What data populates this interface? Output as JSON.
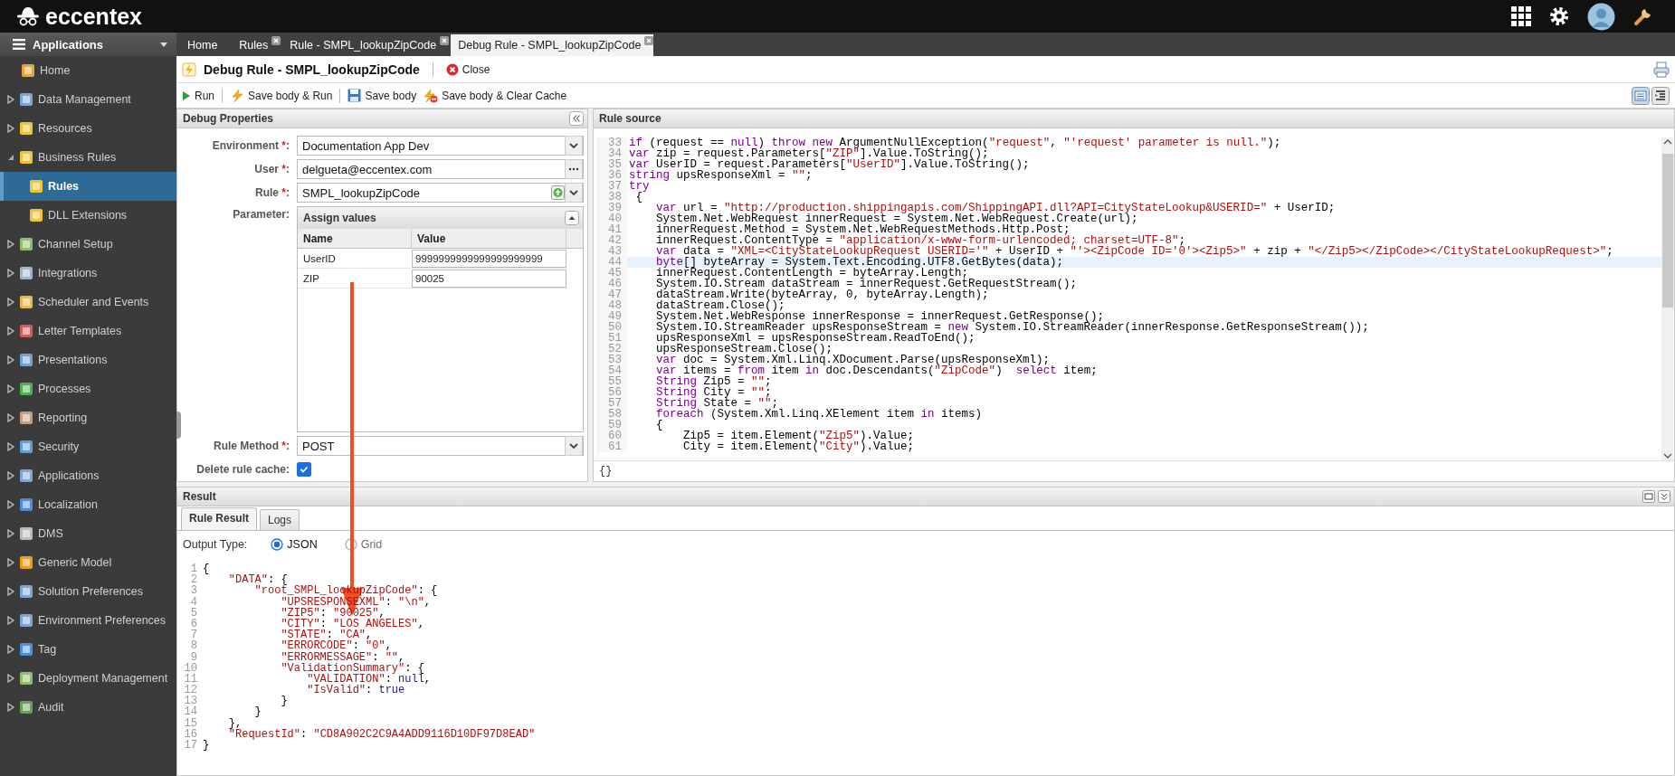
{
  "topbar": {
    "logo": "eccentex"
  },
  "sidebar": {
    "header": "Applications",
    "items": [
      {
        "label": "Home",
        "selected": false
      },
      {
        "label": "Data Management",
        "expanded": false,
        "selected": false
      },
      {
        "label": "Resources",
        "expanded": false,
        "selected": false
      },
      {
        "label": "Business Rules",
        "expanded": true,
        "selected": false,
        "children": [
          {
            "label": "Rules",
            "selected": true
          },
          {
            "label": "DLL Extensions",
            "selected": false
          }
        ]
      },
      {
        "label": "Channel Setup",
        "expanded": false,
        "selected": false
      },
      {
        "label": "Integrations",
        "expanded": false,
        "selected": false
      },
      {
        "label": "Scheduler and Events",
        "expanded": false,
        "selected": false
      },
      {
        "label": "Letter Templates",
        "expanded": false,
        "selected": false
      },
      {
        "label": "Presentations",
        "expanded": false,
        "selected": false
      },
      {
        "label": "Processes",
        "expanded": false,
        "selected": false
      },
      {
        "label": "Reporting",
        "expanded": false,
        "selected": false
      },
      {
        "label": "Security",
        "expanded": false,
        "selected": false
      },
      {
        "label": "Applications",
        "expanded": false,
        "selected": false
      },
      {
        "label": "Localization",
        "expanded": false,
        "selected": false
      },
      {
        "label": "DMS",
        "expanded": false,
        "selected": false
      },
      {
        "label": "Generic Model",
        "expanded": false,
        "selected": false
      },
      {
        "label": "Solution Preferences",
        "expanded": false,
        "selected": false
      },
      {
        "label": "Environment Preferences",
        "expanded": false,
        "selected": false
      },
      {
        "label": "Tag",
        "expanded": false,
        "selected": false
      },
      {
        "label": "Deployment Management",
        "expanded": false,
        "selected": false
      },
      {
        "label": "Audit",
        "expanded": false,
        "selected": false
      }
    ]
  },
  "tabs": [
    {
      "label": "Home",
      "closable": false,
      "selected": false
    },
    {
      "label": "Rules",
      "closable": true,
      "selected": false
    },
    {
      "label": "Rule - SMPL_lookupZipCode",
      "closable": true,
      "selected": false
    },
    {
      "label": "Debug Rule - SMPL_lookupZipCode",
      "closable": true,
      "selected": true
    }
  ],
  "page": {
    "title": "Debug Rule - SMPL_lookupZipCode",
    "close": "Close"
  },
  "toolbar": [
    {
      "kind": "run",
      "label": "Run"
    },
    {
      "kind": "save-run",
      "label": "Save body & Run"
    },
    {
      "kind": "save",
      "label": "Save body"
    },
    {
      "kind": "save-clear",
      "label": "Save body & Clear Cache"
    }
  ],
  "debug_properties": {
    "title": "Debug Properties",
    "fields": [
      {
        "kind": "select",
        "label": "Environment",
        "required_mark": "*",
        "colon": ":",
        "value": "Documentation App Dev"
      },
      {
        "kind": "lookup",
        "label": "User",
        "required_mark": "*",
        "colon": ":",
        "value": "delgueta@eccentex.com"
      },
      {
        "kind": "rule-select",
        "label": "Rule",
        "required_mark": "*",
        "colon": ":",
        "value": "SMPL_lookupZipCode"
      },
      {
        "kind": "parameters",
        "label": "Parameter:",
        "grid": {
          "title": "Assign values",
          "columns": [
            "Name",
            "Value"
          ],
          "rows": [
            {
              "name": "UserID",
              "value": "9999999999999999999999"
            },
            {
              "name": "ZIP",
              "value": "90025"
            }
          ]
        }
      },
      {
        "kind": "select",
        "label": "Rule Method",
        "required_mark": "*",
        "colon": ":",
        "value": "POST"
      },
      {
        "kind": "checkbox",
        "label": "Delete rule cache:",
        "checked": true
      }
    ]
  },
  "rule_source": {
    "title": "Rule source",
    "status": "{}",
    "lines": [
      {
        "number": "33",
        "highlighted": false,
        "tokens": [
          {
            "kind": "keyword",
            "text": "if"
          },
          {
            "kind": "plain",
            "text": " (request == "
          },
          {
            "kind": "keyword",
            "text": "null"
          },
          {
            "kind": "plain",
            "text": ") "
          },
          {
            "kind": "keyword",
            "text": "throw new"
          },
          {
            "kind": "plain",
            "text": " ArgumentNullException("
          },
          {
            "kind": "string",
            "text": "\"request\""
          },
          {
            "kind": "plain",
            "text": ", "
          },
          {
            "kind": "string",
            "text": "\"'request' parameter is null.\""
          },
          {
            "kind": "plain",
            "text": ");"
          }
        ]
      },
      {
        "number": "34",
        "highlighted": false,
        "tokens": [
          {
            "kind": "keyword",
            "text": "var"
          },
          {
            "kind": "plain",
            "text": " zip = request.Parameters["
          },
          {
            "kind": "string",
            "text": "\"ZIP\""
          },
          {
            "kind": "plain",
            "text": "].Value.ToString();"
          }
        ]
      },
      {
        "number": "35",
        "highlighted": false,
        "tokens": [
          {
            "kind": "keyword",
            "text": "var"
          },
          {
            "kind": "plain",
            "text": " UserID = request.Parameters["
          },
          {
            "kind": "string",
            "text": "\"UserID\""
          },
          {
            "kind": "plain",
            "text": "].Value.ToString();"
          }
        ]
      },
      {
        "number": "36",
        "highlighted": false,
        "tokens": [
          {
            "kind": "keyword",
            "text": "string"
          },
          {
            "kind": "plain",
            "text": " upsResponseXml = "
          },
          {
            "kind": "string",
            "text": "\"\""
          },
          {
            "kind": "plain",
            "text": ";"
          }
        ]
      },
      {
        "number": "37",
        "highlighted": false,
        "tokens": [
          {
            "kind": "keyword",
            "text": "try"
          }
        ]
      },
      {
        "number": "38",
        "highlighted": false,
        "tokens": [
          {
            "kind": "plain",
            "text": " {"
          }
        ]
      },
      {
        "number": "39",
        "highlighted": false,
        "tokens": [
          {
            "kind": "keyword",
            "text": "    var"
          },
          {
            "kind": "plain",
            "text": " url = "
          },
          {
            "kind": "string",
            "text": "\"http://production.shippingapis.com/ShippingAPI.dll?API=CityStateLookup&USERID=\""
          },
          {
            "kind": "plain",
            "text": " + UserID;"
          }
        ]
      },
      {
        "number": "40",
        "highlighted": false,
        "tokens": [
          {
            "kind": "plain",
            "text": "    System.Net.WebRequest innerRequest = System.Net.WebRequest.Create(url);"
          }
        ]
      },
      {
        "number": "41",
        "highlighted": false,
        "tokens": [
          {
            "kind": "plain",
            "text": "    innerRequest.Method = System.Net.WebRequestMethods.Http.Post;"
          }
        ]
      },
      {
        "number": "42",
        "highlighted": false,
        "tokens": [
          {
            "kind": "plain",
            "text": "    innerRequest.ContentType = "
          },
          {
            "kind": "string",
            "text": "\"application/x-www-form-urlencoded; charset=UTF-8\""
          },
          {
            "kind": "plain",
            "text": ";"
          }
        ]
      },
      {
        "number": "43",
        "highlighted": false,
        "tokens": [
          {
            "kind": "keyword",
            "text": "    var"
          },
          {
            "kind": "plain",
            "text": " data = "
          },
          {
            "kind": "string",
            "text": "\"XML=<CityStateLookupRequest USERID='\""
          },
          {
            "kind": "plain",
            "text": " + UserID + "
          },
          {
            "kind": "string",
            "text": "\"'><ZipCode ID='0'><Zip5>\""
          },
          {
            "kind": "plain",
            "text": " + zip + "
          },
          {
            "kind": "string",
            "text": "\"</Zip5></ZipCode></CityStateLookupRequest>\""
          },
          {
            "kind": "plain",
            "text": ";"
          }
        ]
      },
      {
        "number": "44",
        "highlighted": true,
        "tokens": [
          {
            "kind": "keyword",
            "text": "    byte"
          },
          {
            "kind": "plain",
            "text": "[] byteArray = System.Text.Encoding.UTF8.GetBytes(data);"
          }
        ]
      },
      {
        "number": "45",
        "highlighted": false,
        "tokens": [
          {
            "kind": "plain",
            "text": "    innerRequest.ContentLength = byteArray.Length;"
          }
        ]
      },
      {
        "number": "46",
        "highlighted": false,
        "tokens": [
          {
            "kind": "plain",
            "text": "    System.IO.Stream dataStream = innerRequest.GetRequestStream();"
          }
        ]
      },
      {
        "number": "47",
        "highlighted": false,
        "tokens": [
          {
            "kind": "plain",
            "text": "    dataStream.Write(byteArray, 0, byteArray.Length);"
          }
        ]
      },
      {
        "number": "48",
        "highlighted": false,
        "tokens": [
          {
            "kind": "plain",
            "text": "    dataStream.Close();"
          }
        ]
      },
      {
        "number": "49",
        "highlighted": false,
        "tokens": [
          {
            "kind": "plain",
            "text": "    System.Net.WebResponse innerResponse = innerRequest.GetResponse();"
          }
        ]
      },
      {
        "number": "50",
        "highlighted": false,
        "tokens": [
          {
            "kind": "plain",
            "text": "    System.IO.StreamReader upsResponseStream = "
          },
          {
            "kind": "keyword",
            "text": "new"
          },
          {
            "kind": "plain",
            "text": " System.IO.StreamReader(innerResponse.GetResponseStream());"
          }
        ]
      },
      {
        "number": "51",
        "highlighted": false,
        "tokens": [
          {
            "kind": "plain",
            "text": "    upsResponseXml = upsResponseStream.ReadToEnd();"
          }
        ]
      },
      {
        "number": "52",
        "highlighted": false,
        "tokens": [
          {
            "kind": "plain",
            "text": "    upsResponseStream.Close();"
          }
        ]
      },
      {
        "number": "53",
        "highlighted": false,
        "tokens": [
          {
            "kind": "keyword",
            "text": "    var"
          },
          {
            "kind": "plain",
            "text": " doc = System.Xml.Linq.XDocument.Parse(upsResponseXml);"
          }
        ]
      },
      {
        "number": "54",
        "highlighted": false,
        "tokens": [
          {
            "kind": "keyword",
            "text": "    var"
          },
          {
            "kind": "plain",
            "text": " items = "
          },
          {
            "kind": "keyword",
            "text": "from"
          },
          {
            "kind": "plain",
            "text": " item "
          },
          {
            "kind": "keyword",
            "text": "in"
          },
          {
            "kind": "plain",
            "text": " doc.Descendants("
          },
          {
            "kind": "string",
            "text": "\"ZipCode\""
          },
          {
            "kind": "plain",
            "text": ")  "
          },
          {
            "kind": "keyword",
            "text": "select"
          },
          {
            "kind": "plain",
            "text": " item;"
          }
        ]
      },
      {
        "number": "55",
        "highlighted": false,
        "tokens": [
          {
            "kind": "keyword",
            "text": "    String"
          },
          {
            "kind": "plain",
            "text": " Zip5 = "
          },
          {
            "kind": "string",
            "text": "\"\""
          },
          {
            "kind": "plain",
            "text": ";"
          }
        ]
      },
      {
        "number": "56",
        "highlighted": false,
        "tokens": [
          {
            "kind": "keyword",
            "text": "    String"
          },
          {
            "kind": "plain",
            "text": " City = "
          },
          {
            "kind": "string",
            "text": "\"\""
          },
          {
            "kind": "plain",
            "text": ";"
          }
        ]
      },
      {
        "number": "57",
        "highlighted": false,
        "tokens": [
          {
            "kind": "keyword",
            "text": "    String"
          },
          {
            "kind": "plain",
            "text": " State = "
          },
          {
            "kind": "string",
            "text": "\"\""
          },
          {
            "kind": "plain",
            "text": ";"
          }
        ]
      },
      {
        "number": "58",
        "highlighted": false,
        "tokens": [
          {
            "kind": "keyword",
            "text": "    foreach"
          },
          {
            "kind": "plain",
            "text": " (System.Xml.Linq.XElement item "
          },
          {
            "kind": "keyword",
            "text": "in"
          },
          {
            "kind": "plain",
            "text": " items)"
          }
        ]
      },
      {
        "number": "59",
        "highlighted": false,
        "tokens": [
          {
            "kind": "plain",
            "text": "    {"
          }
        ]
      },
      {
        "number": "60",
        "highlighted": false,
        "tokens": [
          {
            "kind": "plain",
            "text": "        Zip5 = item.Element("
          },
          {
            "kind": "string",
            "text": "\"Zip5\""
          },
          {
            "kind": "plain",
            "text": ").Value;"
          }
        ]
      },
      {
        "number": "61",
        "highlighted": false,
        "tokens": [
          {
            "kind": "plain",
            "text": "        City = item.Element("
          },
          {
            "kind": "string",
            "text": "\"City\""
          },
          {
            "kind": "plain",
            "text": ").Value;"
          }
        ]
      }
    ]
  },
  "result": {
    "title": "Result",
    "tabs": [
      {
        "label": "Rule Result",
        "selected": true
      },
      {
        "label": "Logs",
        "selected": false
      }
    ],
    "output_type": {
      "label": "Output Type:",
      "options": [
        {
          "label": "JSON",
          "selected": true,
          "disabled": false
        },
        {
          "label": "Grid",
          "selected": false,
          "disabled": true
        }
      ]
    },
    "lines": [
      {
        "number": "1",
        "tokens": [
          {
            "kind": "plain",
            "text": "{"
          }
        ]
      },
      {
        "number": "2",
        "tokens": [
          {
            "kind": "string",
            "text": "    \"DATA\""
          },
          {
            "kind": "plain",
            "text": ": {"
          }
        ]
      },
      {
        "number": "3",
        "tokens": [
          {
            "kind": "string",
            "text": "        \"root_SMPL_lookupZipCode\""
          },
          {
            "kind": "plain",
            "text": ": {"
          }
        ]
      },
      {
        "number": "4",
        "tokens": [
          {
            "kind": "string",
            "text": "            \"UPSRESPONSEXML\""
          },
          {
            "kind": "plain",
            "text": ": "
          },
          {
            "kind": "string",
            "text": "\"\\n\""
          },
          {
            "kind": "plain",
            "text": ","
          }
        ]
      },
      {
        "number": "5",
        "tokens": [
          {
            "kind": "string",
            "text": "            \"ZIP5\""
          },
          {
            "kind": "plain",
            "text": ": "
          },
          {
            "kind": "string",
            "text": "\"90025\""
          },
          {
            "kind": "plain",
            "text": ","
          }
        ]
      },
      {
        "number": "6",
        "tokens": [
          {
            "kind": "string",
            "text": "            \"CITY\""
          },
          {
            "kind": "plain",
            "text": ": "
          },
          {
            "kind": "string",
            "text": "\"LOS ANGELES\""
          },
          {
            "kind": "plain",
            "text": ","
          }
        ]
      },
      {
        "number": "7",
        "tokens": [
          {
            "kind": "string",
            "text": "            \"STATE\""
          },
          {
            "kind": "plain",
            "text": ": "
          },
          {
            "kind": "string",
            "text": "\"CA\""
          },
          {
            "kind": "plain",
            "text": ","
          }
        ]
      },
      {
        "number": "8",
        "tokens": [
          {
            "kind": "string",
            "text": "            \"ERRORCODE\""
          },
          {
            "kind": "plain",
            "text": ": "
          },
          {
            "kind": "string",
            "text": "\"0\""
          },
          {
            "kind": "plain",
            "text": ","
          }
        ]
      },
      {
        "number": "9",
        "tokens": [
          {
            "kind": "string",
            "text": "            \"ERRORMESSAGE\""
          },
          {
            "kind": "plain",
            "text": ": "
          },
          {
            "kind": "string",
            "text": "\"\""
          },
          {
            "kind": "plain",
            "text": ","
          }
        ]
      },
      {
        "number": "10",
        "tokens": [
          {
            "kind": "string",
            "text": "            \"ValidationSummary\""
          },
          {
            "kind": "plain",
            "text": ": {"
          }
        ]
      },
      {
        "number": "11",
        "tokens": [
          {
            "kind": "string",
            "text": "                \"VALIDATION\""
          },
          {
            "kind": "plain",
            "text": ": "
          },
          {
            "kind": "literal",
            "text": "null"
          },
          {
            "kind": "plain",
            "text": ","
          }
        ]
      },
      {
        "number": "12",
        "tokens": [
          {
            "kind": "string",
            "text": "                \"IsValid\""
          },
          {
            "kind": "plain",
            "text": ": "
          },
          {
            "kind": "literal",
            "text": "true"
          }
        ]
      },
      {
        "number": "13",
        "tokens": [
          {
            "kind": "plain",
            "text": "            }"
          }
        ]
      },
      {
        "number": "14",
        "tokens": [
          {
            "kind": "plain",
            "text": "        }"
          }
        ]
      },
      {
        "number": "15",
        "tokens": [
          {
            "kind": "plain",
            "text": "    },"
          }
        ]
      },
      {
        "number": "16",
        "tokens": [
          {
            "kind": "string",
            "text": "    \"RequestId\""
          },
          {
            "kind": "plain",
            "text": ": "
          },
          {
            "kind": "string",
            "text": "\"CD8A902C2C9A4ADD9116D10DF97D8EAD\""
          }
        ]
      },
      {
        "number": "17",
        "tokens": [
          {
            "kind": "plain",
            "text": "}"
          }
        ]
      }
    ]
  }
}
